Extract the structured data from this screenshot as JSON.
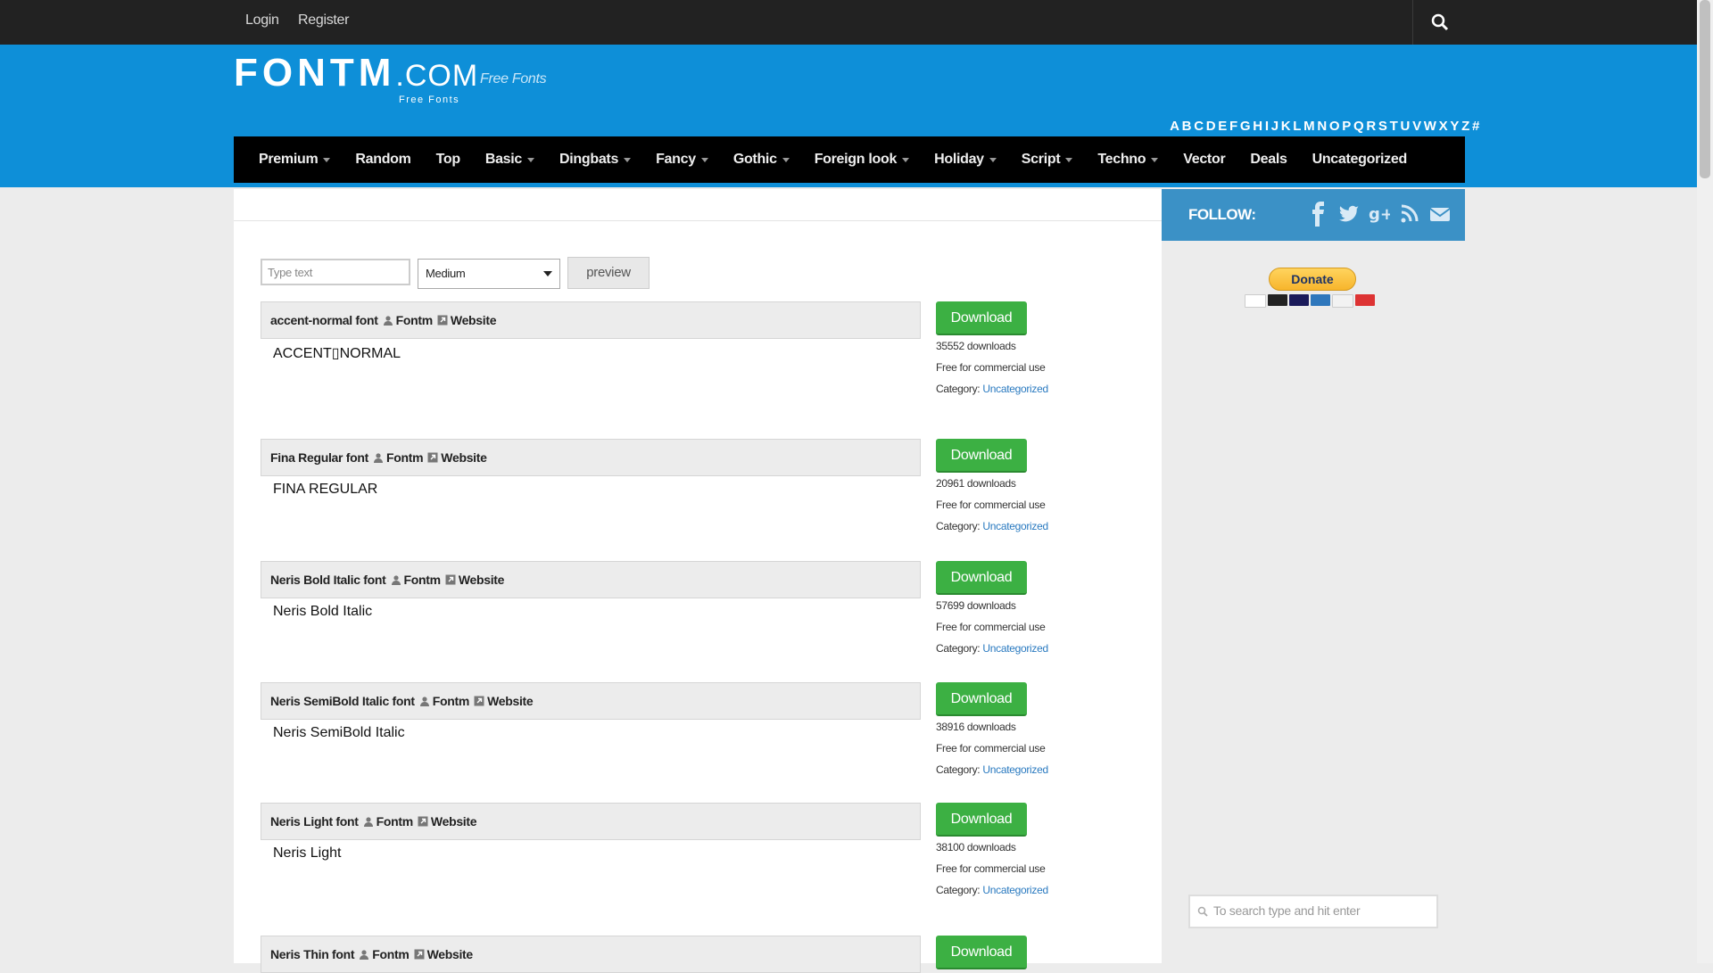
{
  "topbar": {
    "login": "Login",
    "register": "Register"
  },
  "header": {
    "logo_main": "FONTM",
    "logo_tld": ".COM",
    "logo_sub": "Free Fonts",
    "tagline": "Free Fonts",
    "alphabet": [
      "A",
      "B",
      "C",
      "D",
      "E",
      "F",
      "G",
      "H",
      "I",
      "J",
      "K",
      "L",
      "M",
      "N",
      "O",
      "P",
      "Q",
      "R",
      "S",
      "T",
      "U",
      "V",
      "W",
      "X",
      "Y",
      "Z",
      "#"
    ]
  },
  "nav": [
    {
      "label": "Premium",
      "dropdown": true
    },
    {
      "label": "Random",
      "dropdown": false
    },
    {
      "label": "Top",
      "dropdown": false
    },
    {
      "label": "Basic",
      "dropdown": true
    },
    {
      "label": "Dingbats",
      "dropdown": true
    },
    {
      "label": "Fancy",
      "dropdown": true
    },
    {
      "label": "Gothic",
      "dropdown": true
    },
    {
      "label": "Foreign look",
      "dropdown": true
    },
    {
      "label": "Holiday",
      "dropdown": true
    },
    {
      "label": "Script",
      "dropdown": true
    },
    {
      "label": "Techno",
      "dropdown": true
    },
    {
      "label": "Vector",
      "dropdown": false
    },
    {
      "label": "Deals",
      "dropdown": false
    },
    {
      "label": "Uncategorized",
      "dropdown": false
    }
  ],
  "preview_bar": {
    "placeholder": "Type text",
    "size_selected": "Medium",
    "button": "preview"
  },
  "fonts": [
    {
      "name": "accent-normal font",
      "author": "Fontm",
      "website": "Website",
      "sample": "ACCENT▯NORMAL",
      "downloads": "35552 downloads",
      "license": "Free for commercial use",
      "category_label": "Category:",
      "category": "Uncategorized",
      "button": "Download"
    },
    {
      "name": "Fina Regular font",
      "author": "Fontm",
      "website": "Website",
      "sample": "FINA REGULAR",
      "downloads": "20961 downloads",
      "license": "Free for commercial use",
      "category_label": "Category:",
      "category": "Uncategorized",
      "button": "Download"
    },
    {
      "name": "Neris Bold Italic font",
      "author": "Fontm",
      "website": "Website",
      "sample": "Neris Bold Italic",
      "downloads": "57699 downloads",
      "license": "Free for commercial use",
      "category_label": "Category:",
      "category": "Uncategorized",
      "button": "Download"
    },
    {
      "name": "Neris SemiBold Italic font",
      "author": "Fontm",
      "website": "Website",
      "sample": "Neris SemiBold Italic",
      "downloads": "38916 downloads",
      "license": "Free for commercial use",
      "category_label": "Category:",
      "category": "Uncategorized",
      "button": "Download"
    },
    {
      "name": "Neris Light font",
      "author": "Fontm",
      "website": "Website",
      "sample": "Neris Light",
      "downloads": "38100 downloads",
      "license": "Free for commercial use",
      "category_label": "Category:",
      "category": "Uncategorized",
      "button": "Download"
    },
    {
      "name": "Neris Thin font",
      "author": "Fontm",
      "website": "Website",
      "button": "Download"
    }
  ],
  "sidebar": {
    "follow": "FOLLOW:",
    "social_icons": [
      "facebook-icon",
      "twitter-icon",
      "google-plus-icon",
      "rss-icon",
      "email-icon"
    ],
    "donate": "Donate",
    "search_placeholder": "To search type and hit enter"
  },
  "colors": {
    "header_blue": "#0e8fd8",
    "download_green": "#3cb043",
    "follow_blue": "#3b91c6"
  }
}
